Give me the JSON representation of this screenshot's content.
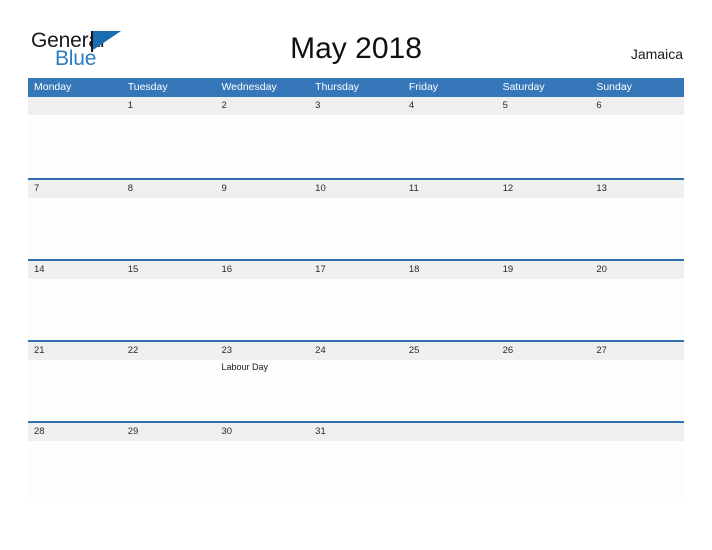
{
  "brand": {
    "word_one": "General",
    "word_two": "Blue",
    "flag_icon": "flag-triangle-icon"
  },
  "header": {
    "title": "May 2018",
    "country": "Jamaica"
  },
  "calendar": {
    "day_headers": [
      "Monday",
      "Tuesday",
      "Wednesday",
      "Thursday",
      "Friday",
      "Saturday",
      "Sunday"
    ],
    "weeks": [
      [
        {
          "num": "",
          "event": ""
        },
        {
          "num": "1",
          "event": ""
        },
        {
          "num": "2",
          "event": ""
        },
        {
          "num": "3",
          "event": ""
        },
        {
          "num": "4",
          "event": ""
        },
        {
          "num": "5",
          "event": ""
        },
        {
          "num": "6",
          "event": ""
        }
      ],
      [
        {
          "num": "7",
          "event": ""
        },
        {
          "num": "8",
          "event": ""
        },
        {
          "num": "9",
          "event": ""
        },
        {
          "num": "10",
          "event": ""
        },
        {
          "num": "11",
          "event": ""
        },
        {
          "num": "12",
          "event": ""
        },
        {
          "num": "13",
          "event": ""
        }
      ],
      [
        {
          "num": "14",
          "event": ""
        },
        {
          "num": "15",
          "event": ""
        },
        {
          "num": "16",
          "event": ""
        },
        {
          "num": "17",
          "event": ""
        },
        {
          "num": "18",
          "event": ""
        },
        {
          "num": "19",
          "event": ""
        },
        {
          "num": "20",
          "event": ""
        }
      ],
      [
        {
          "num": "21",
          "event": ""
        },
        {
          "num": "22",
          "event": ""
        },
        {
          "num": "23",
          "event": "Labour Day"
        },
        {
          "num": "24",
          "event": ""
        },
        {
          "num": "25",
          "event": ""
        },
        {
          "num": "26",
          "event": ""
        },
        {
          "num": "27",
          "event": ""
        }
      ],
      [
        {
          "num": "28",
          "event": ""
        },
        {
          "num": "29",
          "event": ""
        },
        {
          "num": "30",
          "event": ""
        },
        {
          "num": "31",
          "event": ""
        },
        {
          "num": "",
          "event": ""
        },
        {
          "num": "",
          "event": ""
        },
        {
          "num": "",
          "event": ""
        }
      ]
    ]
  },
  "colors": {
    "header_blue": "#3577b8",
    "row_rule_blue": "#2f6eaf",
    "band_gray": "#efefef",
    "brand_blue": "#2b7cc4"
  }
}
